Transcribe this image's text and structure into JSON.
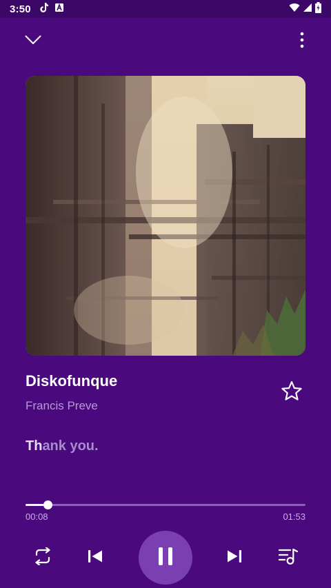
{
  "status_bar": {
    "time": "3:50",
    "left_icons": [
      "tiktok-icon",
      "a-badge-icon"
    ],
    "right_icons": [
      "wifi-icon",
      "signal-icon",
      "battery-icon"
    ]
  },
  "header": {
    "collapse_icon": "chevron-down-icon",
    "more_icon": "more-vert-icon"
  },
  "track": {
    "title": "Diskofunque",
    "artist": "Francis Preve",
    "favorite_icon": "star-outline-icon"
  },
  "lyrics": {
    "sung_part": "Th",
    "unsung_part": "ank you."
  },
  "progress": {
    "elapsed": "00:08",
    "total": "01:53",
    "fraction": 0.08
  },
  "controls": {
    "repeat_icon": "repeat-icon",
    "previous_icon": "skip-previous-icon",
    "play_pause_icon": "pause-icon",
    "next_icon": "skip-next-icon",
    "queue_icon": "queue-music-icon"
  },
  "colors": {
    "background": "#4a0a7e",
    "status_bar": "#3c0868",
    "accent_button": "#7a40b2",
    "secondary_text": "#b79ad6"
  }
}
